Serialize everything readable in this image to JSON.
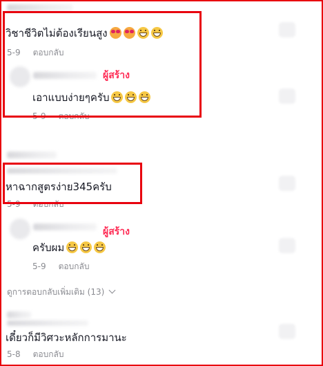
{
  "comments": [
    {
      "text": "วิชาชีวิตไม่ต้องเรียนสูง",
      "emojis": [
        "love-face-icon",
        "love-face-icon",
        "grin-face-icon",
        "grin-face-icon"
      ],
      "date": "5-9",
      "reply": "ตอบกลับ"
    },
    {
      "author_tag": "ผู้สร้าง",
      "text": "เอาแบบง่ายๆครับ",
      "emojis": [
        "grin-face-icon",
        "grin-face-icon",
        "grin-face-icon"
      ],
      "date": "5-9",
      "reply": "ตอบกลับ"
    },
    {
      "text": "หาฉากสูตรง่าย345ครับ",
      "emojis": [],
      "date": "5-9",
      "reply": "ตอบกลับ"
    },
    {
      "author_tag": "ผู้สร้าง",
      "text": "ครับผม",
      "emojis": [
        "grin-face-icon",
        "grin-face-icon",
        "grin-face-icon"
      ],
      "date": "5-9",
      "reply": "ตอบกลับ"
    },
    {
      "text": "เดี๋ยวก็มีวิศวะหลักการมานะ",
      "emojis": [],
      "date": "5-8",
      "reply": "ตอบกลับ"
    }
  ],
  "view_more": "ดูการตอบกลับเพิ่มเติม (13)",
  "colors": {
    "highlight": "#e8000e",
    "creator": "#fe2c55",
    "meta": "#8a8b91"
  }
}
